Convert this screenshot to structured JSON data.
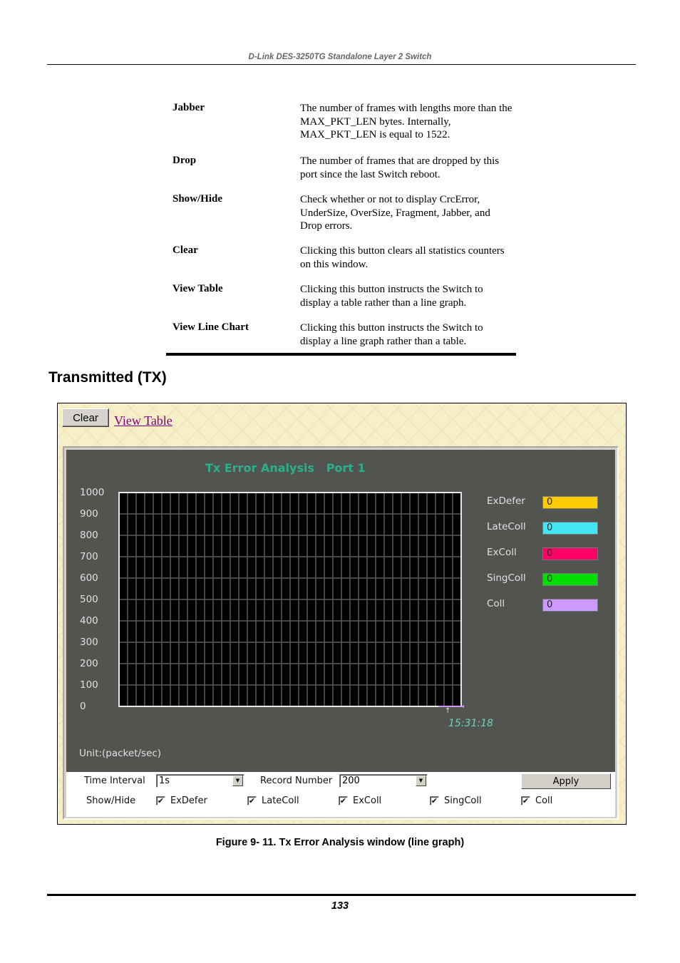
{
  "header": {
    "running_title": "D-Link DES-3250TG Standalone Layer 2 Switch"
  },
  "definitions": [
    {
      "term": "Jabber",
      "description": "The number of frames with lengths more than the MAX_PKT_LEN bytes. Internally, MAX_PKT_LEN is equal to 1522."
    },
    {
      "term": "Drop",
      "description": "The number of frames that are dropped by this port since the last Switch reboot."
    },
    {
      "term": "Show/Hide",
      "description": "Check whether or not to display CrcError, UnderSize, OverSize, Fragment, Jabber, and Drop errors."
    },
    {
      "term": "Clear",
      "description": "Clicking this button clears all statistics counters on this window."
    },
    {
      "term": "View Table",
      "description": "Clicking this button instructs the Switch to display a table rather than a line graph."
    },
    {
      "term": "View Line Chart",
      "description": "Clicking this button instructs the Switch to display a line graph rather than a table."
    }
  ],
  "section_title": "Transmitted (TX)",
  "figure": {
    "clear_button": "Clear",
    "view_table_link": "View Table",
    "chart_title": "Tx Error Analysis   Port 1",
    "unit_label": "Unit:(packet/sec)",
    "time_stamp": "15:31:18",
    "legend": [
      {
        "name": "ExDefer",
        "value": "0",
        "color": "#ffcc00"
      },
      {
        "name": "LateColl",
        "value": "0",
        "color": "#44e6f4"
      },
      {
        "name": "ExColl",
        "value": "0",
        "color": "#ff0066"
      },
      {
        "name": "SingColl",
        "value": "0",
        "color": "#00dd00"
      },
      {
        "name": "Coll",
        "value": "0",
        "color": "#cc99ff"
      }
    ],
    "controls": {
      "time_interval_label": "Time Interval",
      "time_interval_value": "1s",
      "record_number_label": "Record Number",
      "record_number_value": "200",
      "apply_button": "Apply",
      "show_hide_label": "Show/Hide",
      "checkboxes": [
        {
          "label": "ExDefer",
          "checked": true
        },
        {
          "label": "LateColl",
          "checked": true
        },
        {
          "label": "ExColl",
          "checked": true
        },
        {
          "label": "SingColl",
          "checked": true
        },
        {
          "label": "Coll",
          "checked": true
        }
      ],
      "check_glyph": "✔"
    }
  },
  "chart_data": {
    "type": "line",
    "title": "Tx Error Analysis   Port 1",
    "xlabel": "",
    "ylabel": "Unit:(packet/sec)",
    "ylim": [
      0,
      1000
    ],
    "yticks": [
      "1000",
      "900",
      "800",
      "700",
      "600",
      "500",
      "400",
      "300",
      "200",
      "100",
      "0"
    ],
    "grid": true,
    "grid_columns": 40,
    "grid_rows": 10,
    "x_last_label": "15:31:18",
    "legend_position": "right",
    "series": [
      {
        "name": "ExDefer",
        "color": "#ffcc00",
        "values": [
          0
        ]
      },
      {
        "name": "LateColl",
        "color": "#44e6f4",
        "values": [
          0
        ]
      },
      {
        "name": "ExColl",
        "color": "#ff0066",
        "values": [
          0
        ]
      },
      {
        "name": "SingColl",
        "color": "#00dd00",
        "values": [
          0
        ]
      },
      {
        "name": "Coll",
        "color": "#cc99ff",
        "values": [
          0
        ]
      }
    ]
  },
  "caption": "Figure 9- 11.  Tx Error Analysis window (line graph)",
  "footer": {
    "page_number": "133"
  }
}
